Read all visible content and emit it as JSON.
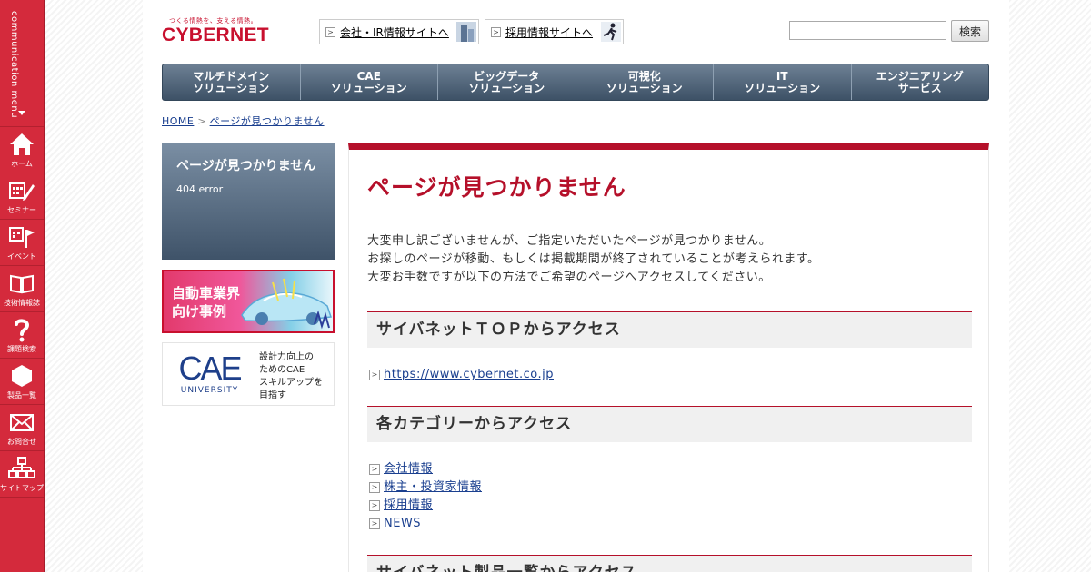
{
  "sidebar": {
    "communication_menu": "communication menu",
    "items": [
      {
        "label": "ホーム",
        "icon": "home-icon"
      },
      {
        "label": "セミナー",
        "icon": "calendar-pen-icon"
      },
      {
        "label": "イベント",
        "icon": "calendar-flag-icon"
      },
      {
        "label": "技術情報誌",
        "icon": "book-icon"
      },
      {
        "label": "課題検索",
        "icon": "question-icon"
      },
      {
        "label": "製品一覧",
        "icon": "hexagon-icon"
      },
      {
        "label": "お問合せ",
        "icon": "mail-icon"
      },
      {
        "label": "サイトマップ",
        "icon": "sitemap-icon"
      }
    ]
  },
  "header": {
    "logo_tagline": "つくる情熱を、支える情熱。",
    "logo_name": "CYBERNET",
    "ir_link": "会社・IR情報サイトへ",
    "recruit_link": "採用情報サイトへ",
    "search_button": "検索",
    "search_value": ""
  },
  "gnav": [
    {
      "line1": "マルチドメイン",
      "line2": "ソリューション"
    },
    {
      "line1": "CAE",
      "line2": "ソリューション"
    },
    {
      "line1": "ビッグデータ",
      "line2": "ソリューション"
    },
    {
      "line1": "可視化",
      "line2": "ソリューション"
    },
    {
      "line1": "IT",
      "line2": "ソリューション"
    },
    {
      "line1": "エンジニアリング",
      "line2": "サービス"
    }
  ],
  "breadcrumb": {
    "home": "HOME",
    "separator": ">",
    "current": "ページが見つかりません"
  },
  "left": {
    "box_title": "ページが見つかりません",
    "box_sub": "404 error",
    "banner_auto_line1": "自動車業界",
    "banner_auto_line2": "向け事例",
    "cae_logo": "CAE",
    "cae_logo_sub": "UNIVERSITY",
    "cae_desc_1": "設計力向上の",
    "cae_desc_2": "ためのCAE",
    "cae_desc_3": "スキルアップを",
    "cae_desc_4": "目指す"
  },
  "content": {
    "title": "ページが見つかりません",
    "intro_1": "大変申し訳ございませんが、ご指定いただいたページが見つかりません。",
    "intro_2": "お探しのページが移動、もしくは掲載期間が終了されていることが考えられます。",
    "intro_3": "大変お手数ですが以下の方法でご希望のページへアクセスしてください。",
    "section1_title": "サイバネットＴＯＰからアクセス",
    "section1_link": "https://www.cybernet.co.jp",
    "section2_title": "各カテゴリーからアクセス",
    "section2_links": [
      "会社情報",
      "株主・投資家情報",
      "採用情報",
      "NEWS"
    ],
    "section3_title": "サイバネット製品一覧からアクセス"
  }
}
